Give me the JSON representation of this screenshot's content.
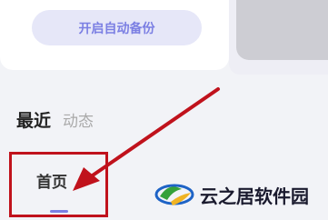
{
  "backup": {
    "button_label": "开启自动备份"
  },
  "recent_tabs": [
    {
      "label": "最近",
      "active": true
    },
    {
      "label": "动态",
      "active": false
    }
  ],
  "bottom_nav": [
    {
      "label": "首页",
      "active": true
    },
    {
      "label": "",
      "active": false
    },
    {
      "label": "",
      "active": false
    }
  ],
  "watermark": {
    "text": "云之居软件园"
  },
  "colors": {
    "accent": "#7b7fe3",
    "annotation_red": "#c0121c",
    "background": "#f2f3f7"
  }
}
